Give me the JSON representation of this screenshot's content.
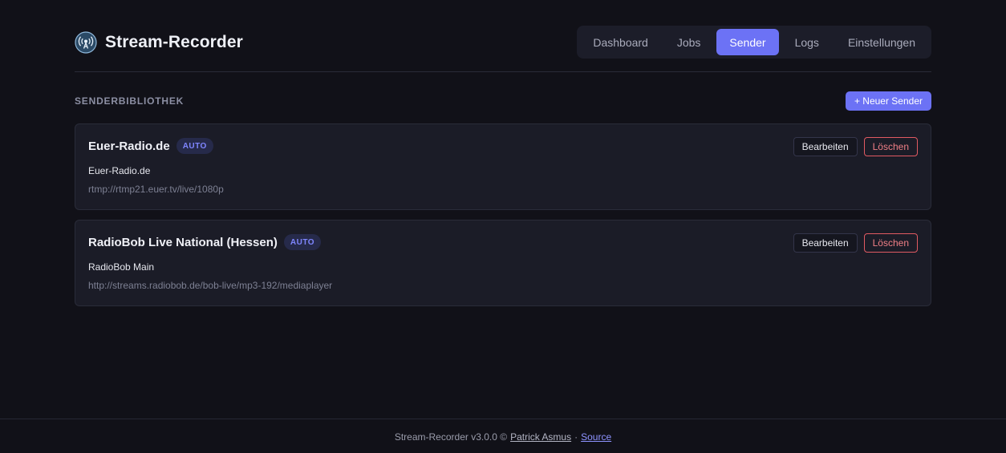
{
  "app": {
    "title": "Stream-Recorder",
    "icon": "broadcast-icon"
  },
  "nav": {
    "items": [
      {
        "label": "Dashboard",
        "active": false
      },
      {
        "label": "Jobs",
        "active": false
      },
      {
        "label": "Sender",
        "active": true
      },
      {
        "label": "Logs",
        "active": false
      },
      {
        "label": "Einstellungen",
        "active": false
      }
    ]
  },
  "section": {
    "title": "SENDERBIBLIOTHEK",
    "new_button": "+ Neuer Sender"
  },
  "stations": [
    {
      "name": "Euer-Radio.de",
      "badge": "AUTO",
      "subtitle": "Euer-Radio.de",
      "url": "rtmp://rtmp21.euer.tv/live/1080p",
      "edit_label": "Bearbeiten",
      "delete_label": "Löschen"
    },
    {
      "name": "RadioBob Live National (Hessen)",
      "badge": "AUTO",
      "subtitle": "RadioBob Main",
      "url": "http://streams.radiobob.de/bob-live/mp3-192/mediaplayer",
      "edit_label": "Bearbeiten",
      "delete_label": "Löschen"
    }
  ],
  "footer": {
    "text": "Stream-Recorder v3.0.0 ©",
    "author": "Patrick Asmus",
    "separator": "·",
    "source": "Source"
  },
  "colors": {
    "background": "#111118",
    "accent": "#6c72f5",
    "card": "#1b1c27",
    "danger": "#e15a62",
    "badge_text": "#7f86ff"
  }
}
